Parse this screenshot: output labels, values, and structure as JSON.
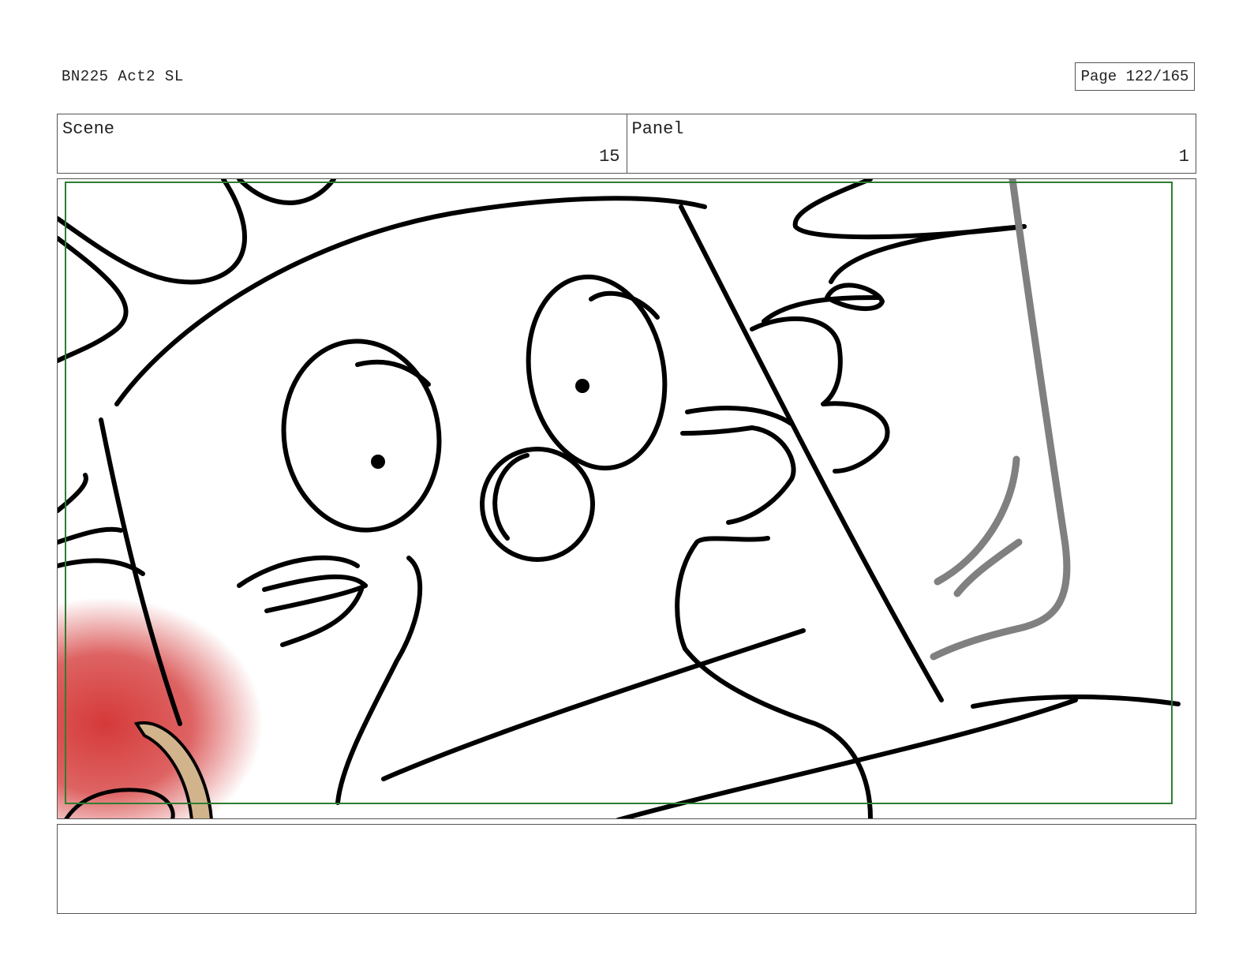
{
  "header": {
    "document_title": "BN225 Act2 SL",
    "page_label": "Page 122/165"
  },
  "info": {
    "scene_label": "Scene",
    "scene_value": "15",
    "panel_label": "Panel",
    "panel_value": "1"
  },
  "frame": {
    "safe_area_color": "#2e7d32",
    "line_color": "#000000",
    "accent_red": "#d32f2f",
    "accent_tan": "#d2b48c",
    "gray_stroke": "#808080"
  },
  "notes": {
    "text": ""
  }
}
